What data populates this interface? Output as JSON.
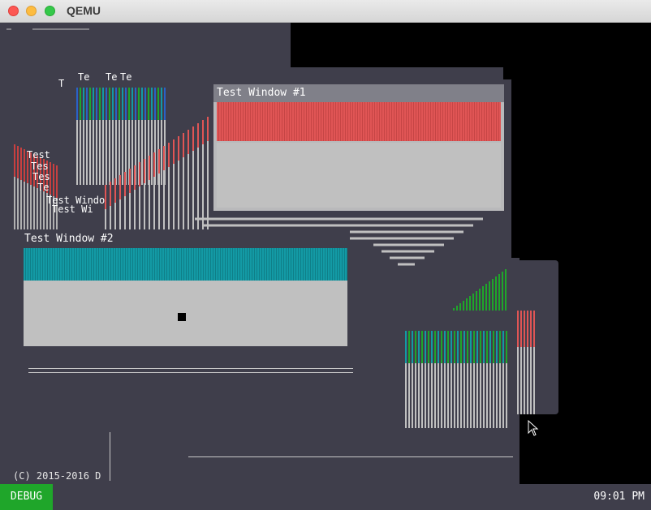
{
  "app": {
    "title": "QEMU"
  },
  "windows": {
    "w1": {
      "title": "Test Window #1",
      "bar_color": "#e05555"
    },
    "w2": {
      "title": "Test Window #2",
      "bar_color": "#139aa5"
    }
  },
  "ghost_labels": [
    "Te",
    "Te",
    "Te",
    "Test",
    "Tes",
    "Tes",
    "Te",
    "Test Windo",
    "Test Wi",
    "T"
  ],
  "footer": {
    "copyright": "(C) 2015-2016 D"
  },
  "taskbar": {
    "debug_label": "DEBUG",
    "clock": "09:01 PM"
  },
  "colors": {
    "desktop": "#3f3e4b",
    "title_bar": "#808089",
    "debug_green": "#1fa62a"
  },
  "icons": [
    "mouse-pointer-icon"
  ]
}
